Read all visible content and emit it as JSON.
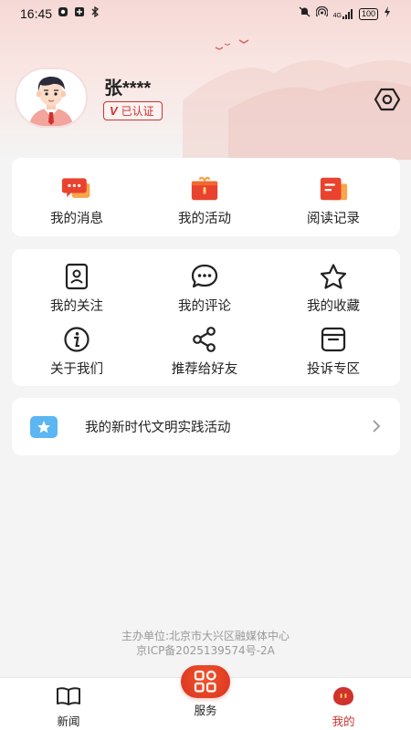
{
  "status_bar": {
    "time": "16:45",
    "network": "4G",
    "battery": "100"
  },
  "profile": {
    "username": "张****",
    "verified_label": "已认证",
    "verified_mark": "V"
  },
  "quick_menu": [
    {
      "label": "我的消息",
      "icon": "message-icon"
    },
    {
      "label": "我的活动",
      "icon": "gift-icon"
    },
    {
      "label": "阅读记录",
      "icon": "reading-record-icon"
    }
  ],
  "menu_grid": [
    {
      "label": "我的关注",
      "icon": "follow-icon"
    },
    {
      "label": "我的评论",
      "icon": "comment-icon"
    },
    {
      "label": "我的收藏",
      "icon": "star-icon"
    },
    {
      "label": "关于我们",
      "icon": "info-icon"
    },
    {
      "label": "推荐给好友",
      "icon": "share-icon"
    },
    {
      "label": "投诉专区",
      "icon": "complaint-box-icon"
    }
  ],
  "practice_entry": {
    "label": "我的新时代文明实践活动"
  },
  "footer": {
    "organizer": "主办单位:北京市大兴区融媒体中心",
    "icp": "京ICP备2025139574号-2A"
  },
  "tabbar": {
    "tabs": [
      {
        "label": "新闻",
        "active": false
      },
      {
        "label": "服务",
        "active": false
      },
      {
        "label": "我的",
        "active": true
      }
    ]
  },
  "colors": {
    "accent": "#d0322d",
    "orange": "#f2552c",
    "hero_pink": "#f6d9d6",
    "background": "#f4f4f4"
  }
}
